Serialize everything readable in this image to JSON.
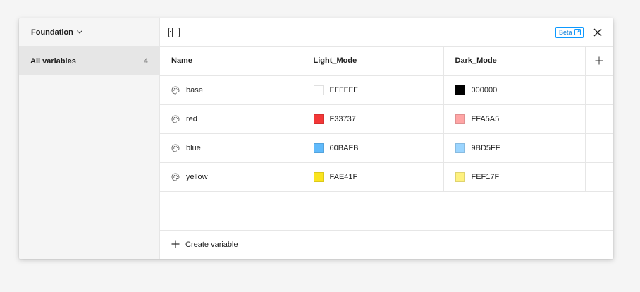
{
  "sidebar": {
    "collection_name": "Foundation",
    "items": [
      {
        "label": "All variables",
        "count": "4"
      }
    ]
  },
  "topbar": {
    "beta_label": "Beta"
  },
  "table": {
    "columns": [
      "Name",
      "Light_Mode",
      "Dark_Mode"
    ],
    "rows": [
      {
        "name": "base",
        "light": "FFFFFF",
        "light_color": "#FFFFFF",
        "dark": "000000",
        "dark_color": "#000000"
      },
      {
        "name": "red",
        "light": "F33737",
        "light_color": "#F33737",
        "dark": "FFA5A5",
        "dark_color": "#FFA5A5"
      },
      {
        "name": "blue",
        "light": "60BAFB",
        "light_color": "#60BAFB",
        "dark": "9BD5FF",
        "dark_color": "#9BD5FF"
      },
      {
        "name": "yellow",
        "light": "FAE41F",
        "light_color": "#FAE41F",
        "dark": "FEF17F",
        "dark_color": "#FEF17F"
      }
    ]
  },
  "footer": {
    "create_label": "Create variable"
  },
  "colors": {
    "accent": "#0D99FF",
    "sidebar_bg": "#F5F5F5",
    "selected_bg": "#E6E6E6",
    "border": "#E6E6E6"
  },
  "icons": {
    "sidebar_toggle": "sidebar-toggle-icon",
    "close": "close-icon",
    "add_column": "plus-icon",
    "variable": "palette-icon",
    "external": "external-link-icon"
  }
}
